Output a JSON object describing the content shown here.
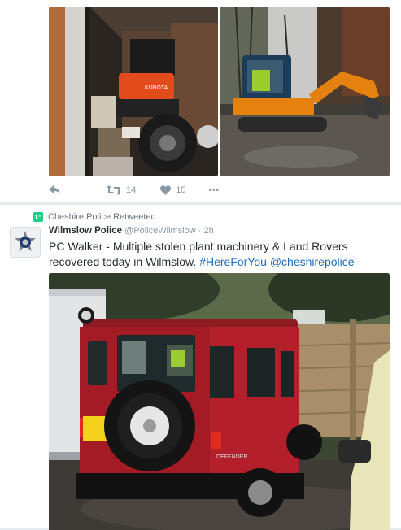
{
  "tweet1": {
    "media": {
      "left_photo_label": "KUBOTA",
      "right_photo_label": "excavator-photo"
    },
    "actions": {
      "reply_icon": "reply-icon",
      "retweet_icon": "retweet-icon",
      "retweet_count": "14",
      "like_icon": "heart-icon",
      "like_count": "15",
      "more_icon": "more-icon",
      "more_label": "•••"
    }
  },
  "tweet2": {
    "context": {
      "icon": "retweet-badge-icon",
      "text": "Cheshire Police Retweeted"
    },
    "author": {
      "name": "Wilmslow Police",
      "handle": "@PoliceWilmslow",
      "separator": "·",
      "time": "2h"
    },
    "text": {
      "body": "PC Walker - Multiple stolen plant machinery & Land Rovers recovered today in Wilmslow. ",
      "hashtag": "#HereForYou",
      "space": " ",
      "mention": "@cheshirepolice"
    },
    "media": {
      "vehicle_badge": "DEFENDER"
    }
  },
  "colors": {
    "link": "#1b6ec2",
    "muted": "#8899a6",
    "retweet_green": "#19cf86",
    "land_rover_red": "#b3202b"
  }
}
